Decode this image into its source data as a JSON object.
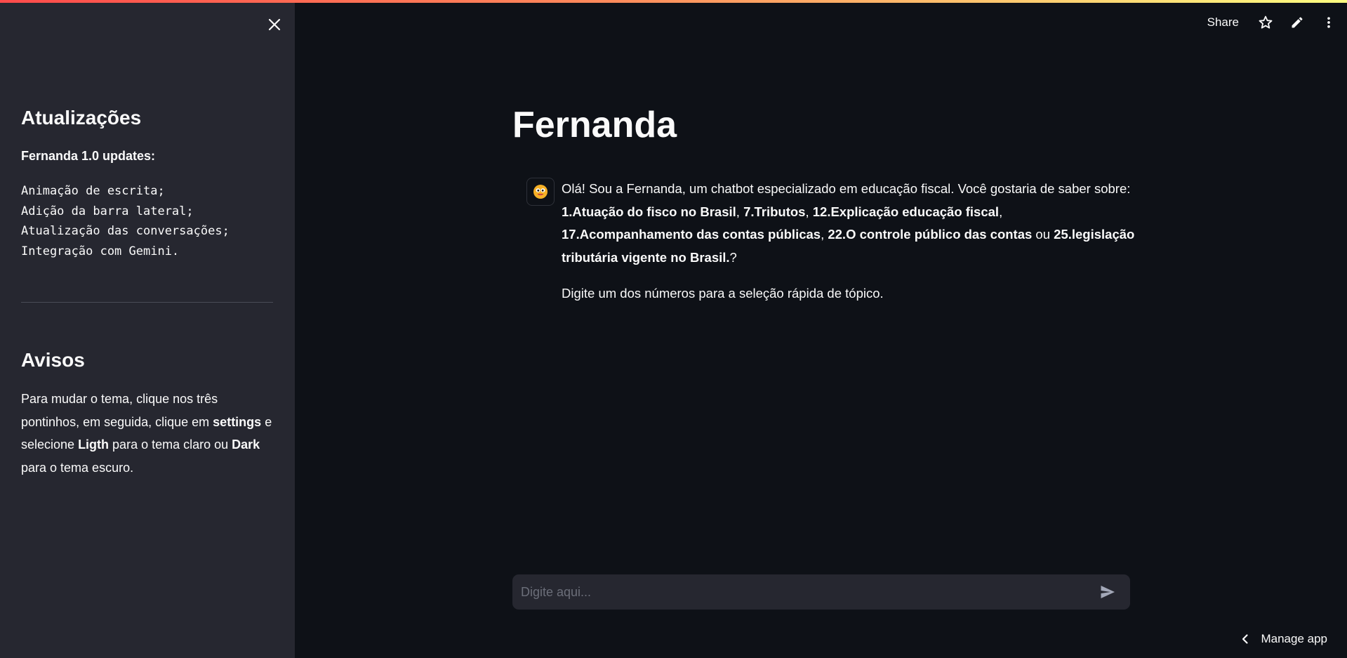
{
  "header": {
    "share_label": "Share",
    "icons": [
      "star-icon",
      "edit-pencil-icon",
      "more-vertical-icon"
    ]
  },
  "sidebar": {
    "close_icon": "close-icon",
    "updates_title": "Atualizações",
    "updates_subtitle": "Fernanda 1.0 updates:",
    "updates_lines": [
      "Animação de escrita;",
      "Adição da barra lateral;",
      "Atualização das conversações;",
      "Integração com Gemini."
    ],
    "notices_title": "Avisos",
    "notice": {
      "part1": "Para mudar o tema, clique nos três pontinhos, em seguida, clique em ",
      "settings": "settings",
      "part2": " e selecione ",
      "light": "Ligth",
      "part3": " para o tema claro ou ",
      "dark": "Dark",
      "part4": " para o tema escuro."
    }
  },
  "main": {
    "title": "Fernanda",
    "message": {
      "avatar_icon": "bot-face-icon",
      "intro": "Olá! Sou a Fernanda, um chatbot especializado em educação fiscal. Você gostaria de saber sobre: ",
      "topic1": "1.Atuação do fisco no Brasil",
      "sep1": ", ",
      "topic2": "7.Tributos",
      "sep2": ", ",
      "topic3": "12.Explicação educação fiscal",
      "sep3": ", ",
      "topic4": "17.Acompanhamento das contas públicas",
      "sep4": ", ",
      "topic5": "22.O controle público das contas",
      "sep5": " ou ",
      "topic6": "25.legislação tributária vigente no Brasil.",
      "end": "?",
      "hint": "Digite um dos números para a seleção rápida de tópico."
    },
    "input": {
      "placeholder": "Digite aqui...",
      "value": ""
    }
  },
  "footer": {
    "manage_app_label": "Manage app"
  },
  "colors": {
    "background": "#0e1117",
    "sidebar": "#262730",
    "input": "#262730",
    "accent_gradient_start": "#ff4b4b",
    "accent_gradient_end": "#fffd80"
  }
}
